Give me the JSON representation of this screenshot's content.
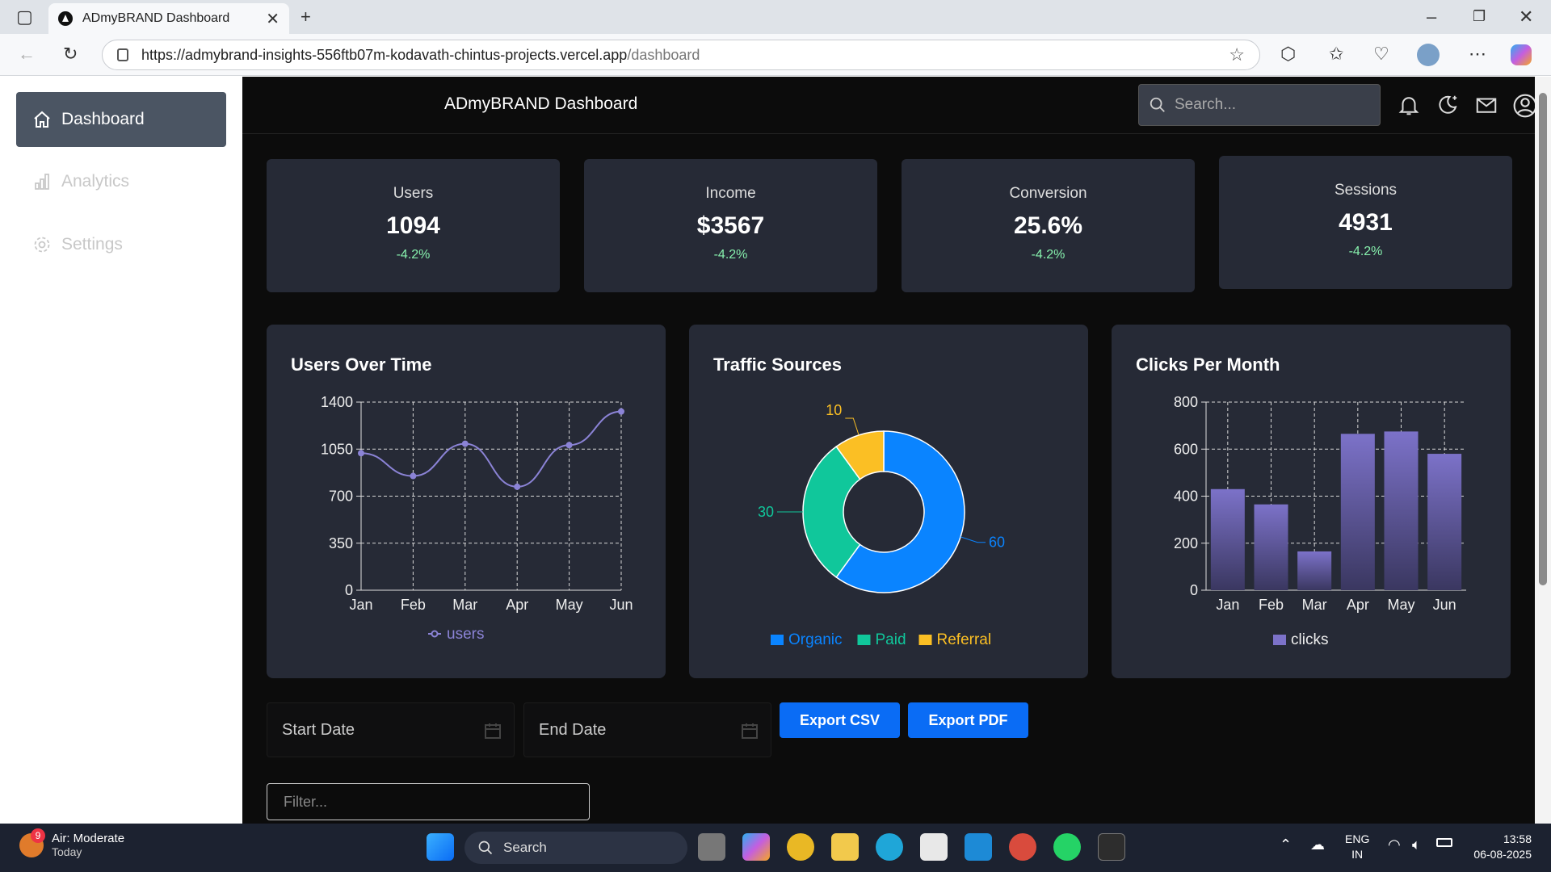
{
  "browser": {
    "tab_title": "ADmyBRAND Dashboard",
    "url_host": "https://admybrand-insights-556ftb07m-kodavath-chintus-projects.vercel.app",
    "url_path": "/dashboard"
  },
  "sidebar": {
    "items": [
      {
        "label": "Dashboard",
        "icon": "home-icon",
        "active": true
      },
      {
        "label": "Analytics",
        "icon": "bar-chart-icon",
        "active": false
      },
      {
        "label": "Settings",
        "icon": "gear-icon",
        "active": false
      }
    ]
  },
  "header": {
    "title": "ADmyBRAND Dashboard",
    "search_placeholder": "Search..."
  },
  "stats": [
    {
      "label": "Users",
      "value": "1094",
      "change": "-4.2%"
    },
    {
      "label": "Income",
      "value": "$3567",
      "change": "-4.2%"
    },
    {
      "label": "Conversion",
      "value": "25.6%",
      "change": "-4.2%"
    },
    {
      "label": "Sessions",
      "value": "4931",
      "change": "-4.2%"
    }
  ],
  "chart_data": [
    {
      "type": "line",
      "title": "Users Over Time",
      "categories": [
        "Jan",
        "Feb",
        "Mar",
        "Apr",
        "May",
        "Jun"
      ],
      "series": [
        {
          "name": "users",
          "values": [
            1020,
            850,
            1090,
            770,
            1080,
            1330
          ],
          "color": "#8b83d6"
        }
      ],
      "yticks": [
        "0",
        "350",
        "700",
        "1050",
        "1400"
      ],
      "ylim": [
        0,
        1400
      ],
      "grid": true,
      "legend": "bottom"
    },
    {
      "type": "pie",
      "title": "Traffic Sources",
      "labels": [
        "Organic",
        "Paid",
        "Referral"
      ],
      "values": [
        60,
        30,
        10
      ],
      "colors": [
        "#0a84ff",
        "#10c79b",
        "#fbbf24"
      ],
      "legend": "bottom"
    },
    {
      "type": "bar",
      "title": "Clicks Per Month",
      "categories": [
        "Jan",
        "Feb",
        "Mar",
        "Apr",
        "May",
        "Jun"
      ],
      "series": [
        {
          "name": "clicks",
          "values": [
            430,
            365,
            165,
            665,
            675,
            580
          ],
          "color": "#7c72c9"
        }
      ],
      "yticks": [
        "0",
        "200",
        "400",
        "600",
        "800"
      ],
      "ylim": [
        0,
        800
      ],
      "grid": true,
      "legend": "bottom"
    }
  ],
  "controls": {
    "start_date": "Start Date",
    "end_date": "End Date",
    "export_csv": "Export CSV",
    "export_pdf": "Export PDF",
    "filter_placeholder": "Filter..."
  },
  "taskbar": {
    "weather_title": "Air: Moderate",
    "weather_sub": "Today",
    "weather_badge": "9",
    "search_label": "Search",
    "lang_top": "ENG",
    "lang_bottom": "IN",
    "time": "13:58",
    "date": "06-08-2025"
  }
}
